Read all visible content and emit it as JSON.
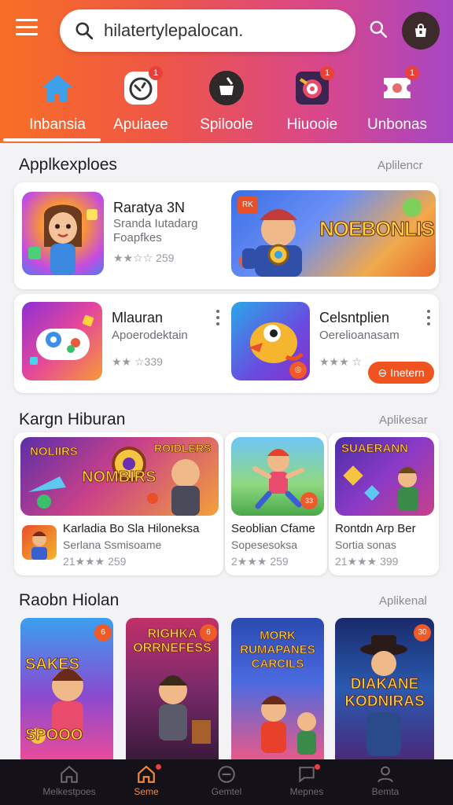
{
  "header": {
    "search_value": "hilatertylepalocan."
  },
  "categories": [
    {
      "label": "Inbansia",
      "icon": "home-icon"
    },
    {
      "label": "Apuiaee",
      "icon": "gamepad-icon",
      "badge": "1"
    },
    {
      "label": "Spiloole",
      "icon": "pencil-bag-icon"
    },
    {
      "label": "Hiuooie",
      "icon": "target-icon",
      "badge": "1"
    },
    {
      "label": "Unbonas",
      "icon": "ticket-icon",
      "badge": "1"
    }
  ],
  "section1": {
    "title": "Applkexploes",
    "link": "Aplilencr",
    "apps": [
      {
        "name": "Raratya 3N",
        "sub1": "Sranda Iutadarg",
        "sub2": "Foapfkes",
        "rating": "★★☆☆ 259"
      },
      {
        "name": "Mlauran",
        "sub1": "Apoerodektain",
        "rating": "★★ ☆339"
      },
      {
        "name": "Celsntplien",
        "sub1": "Oerelioanasam",
        "rating": "★★★ ☆"
      }
    ],
    "banner_badge": "RK",
    "banner_text": "NOEBONLIS",
    "install_label": "Inetern"
  },
  "section2": {
    "title": "Kargn Hiburan",
    "link": "Aplikesar",
    "banner_text1": "NOLIIRS",
    "banner_text2": "NOMBIRS",
    "banner_text3": "ROIDLERS",
    "featured": {
      "name": "Karladia Bo Sla Hiloneksa",
      "sub": "Serlana Ssmisoame",
      "rating": "21★★★ 259"
    },
    "items": [
      {
        "name": "Seoblian Cfame",
        "sub": "Sopesesoksa",
        "rating": "2★★★ 259",
        "tag": "33"
      },
      {
        "name": "Rontdn Arp Ber",
        "sub": "Sortia sonas",
        "rating": "21★★★ 399",
        "banner": "SUAERANN"
      }
    ]
  },
  "section3": {
    "title": "Raobn Hiolan",
    "link": "Aplikenal",
    "posters": [
      {
        "text": "SAKES SPOOO",
        "badge": "6"
      },
      {
        "text": "RIGHKA ORRNEFESS",
        "badge": "6"
      },
      {
        "text": "MORK RUMAPANES CARCILS",
        "badge": ""
      },
      {
        "text": "DIAKANE KODNIRAS",
        "badge": "30"
      }
    ]
  },
  "bottom_nav": [
    {
      "label": "Melkestpoes",
      "icon": "house-outline-icon"
    },
    {
      "label": "Seme",
      "icon": "house-icon",
      "active": true
    },
    {
      "label": "Gemtel",
      "icon": "circle-minus-icon"
    },
    {
      "label": "Mepnes",
      "icon": "message-icon"
    },
    {
      "label": "Bemta",
      "icon": "person-icon"
    }
  ],
  "colors": {
    "accent": "#f0531f",
    "header_start": "#f86f25",
    "header_end": "#a646c4",
    "nav_bg": "#141218"
  }
}
